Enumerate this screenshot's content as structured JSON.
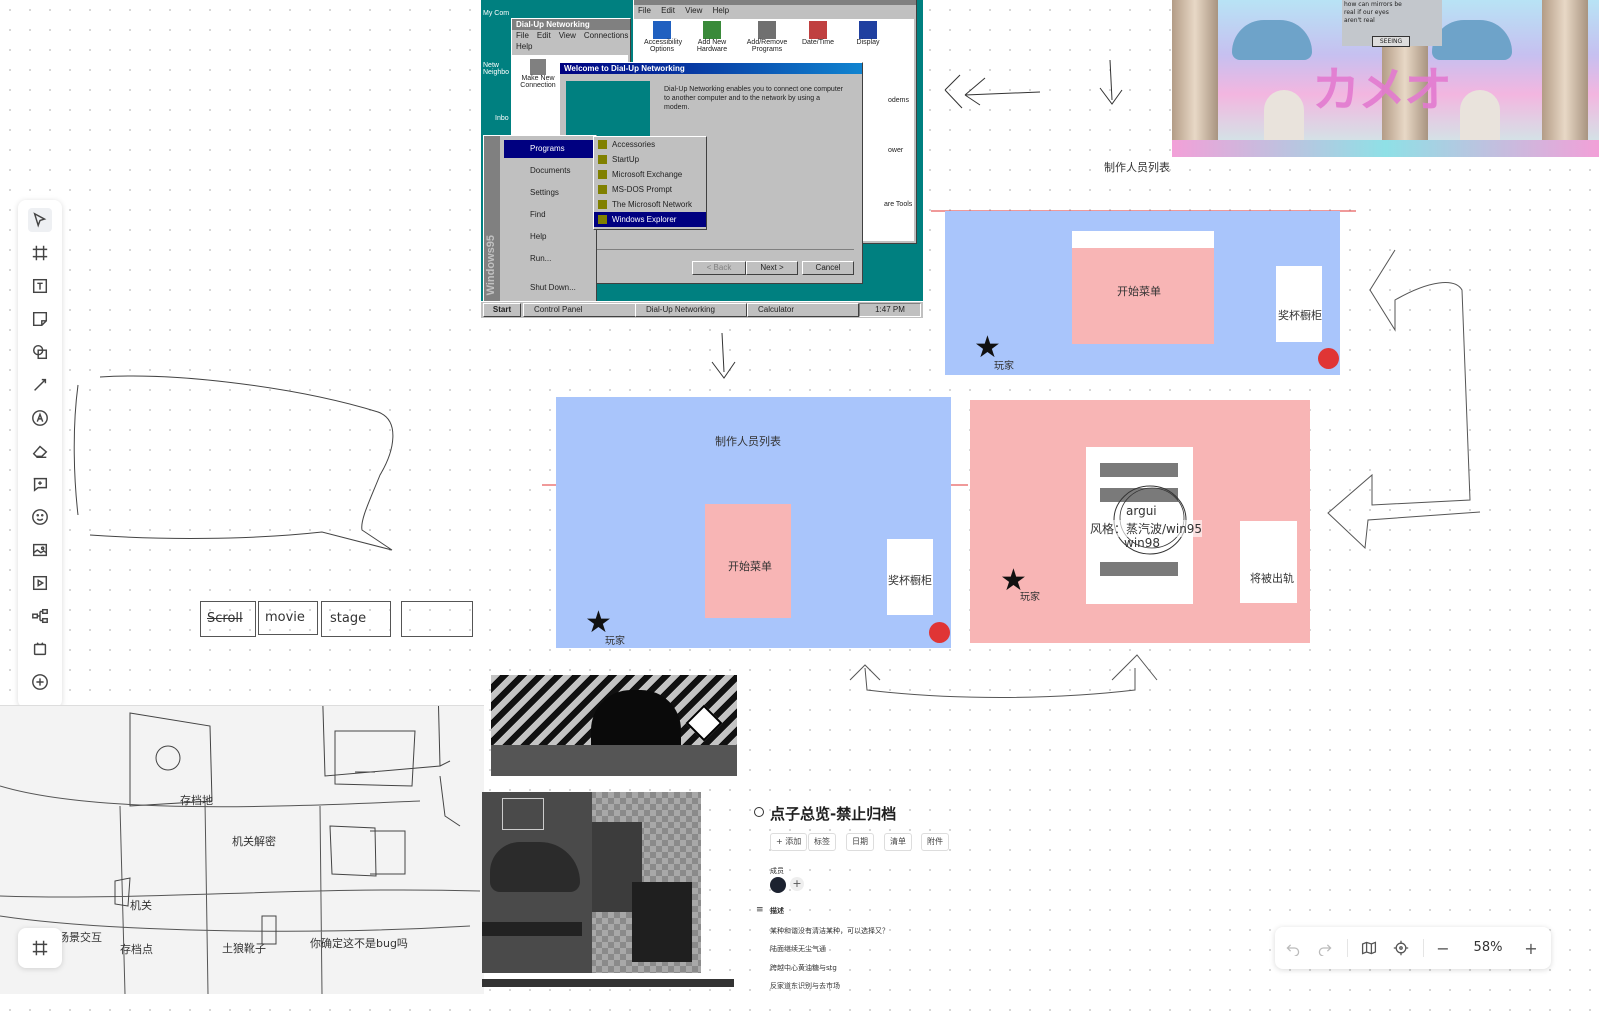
{
  "toolbar": {
    "tools": [
      "select-icon",
      "frame-icon",
      "text-box-icon",
      "sticky-note-icon",
      "shape-icon",
      "connector-icon",
      "pen-icon",
      "eraser-icon",
      "comment-icon",
      "emoji-icon",
      "image-icon",
      "media-icon",
      "mindmap-icon",
      "template-icon",
      "more-icon"
    ]
  },
  "win95": {
    "control_panel_menu": [
      "File",
      "Edit",
      "View",
      "Help"
    ],
    "cp_icons": [
      "Accessibility Options",
      "Add New Hardware",
      "Add/Remove Programs",
      "Date/Time",
      "Display"
    ],
    "cp_side": [
      "odems",
      "ower",
      "are Tools"
    ],
    "dun_title": "Dial-Up Networking",
    "dun_menu": [
      "File",
      "Edit",
      "View",
      "Connections"
    ],
    "dun_menu2": "Help",
    "dun_icon_label": "Make New Connection",
    "desktop_labels": [
      "My Com",
      "Netw Neighbo",
      "Inbo"
    ],
    "welcome_title": "Welcome to Dial-Up Networking",
    "welcome_text": "Dial-Up Networking enables you to connect one computer to another computer and to the network by using a modem.",
    "btn_back": "< Back",
    "btn_next": "Next >",
    "btn_cancel": "Cancel",
    "start_items": [
      "Programs",
      "Documents",
      "Settings",
      "Find",
      "Help",
      "Run...",
      "Shut Down..."
    ],
    "sub_items": [
      "Accessories",
      "StartUp",
      "Microsoft Exchange",
      "MS-DOS Prompt",
      "The Microsoft Network",
      "Windows Explorer"
    ],
    "brand": "Windows95",
    "taskbar": [
      "Start",
      "Control Panel",
      "Dial-Up Networking",
      "Calculator"
    ],
    "clock": "1:47 PM"
  },
  "vapor": {
    "text": "how can mirrors be real if our eyes aren't real",
    "button": "SEEING",
    "katakana": "カメオ"
  },
  "labels": {
    "credits_top": "制作人员列表",
    "credits_mid": "制作人员列表",
    "start_menu_1": "开始菜单",
    "trophy_1": "奖杯橱柜",
    "player_1": "玩家",
    "start_menu_2": "开始菜单",
    "trophy_2": "奖杯橱柜",
    "player_2": "玩家",
    "player_3": "玩家",
    "derail": "将被出轨",
    "argui": "argui",
    "style": "风格：蒸汽波/win95",
    "win98": "win98"
  },
  "handwritten": {
    "boxes": [
      "Scroll",
      "movie",
      "stage",
      ""
    ],
    "save_point": "存档地",
    "mechanism_puzzle": "机关解密",
    "mechanism": "机关",
    "scene_interaction": "场景交互",
    "save_point2": "存档点",
    "earth_wolf": "土狼靴子",
    "sure_bug": "你确定这不是bug吗"
  },
  "doc": {
    "title": "点子总览-禁止归档",
    "chips": [
      "+ 添加",
      "标签",
      "日期",
      "清单",
      "附件"
    ],
    "members_label": "成员",
    "desc_label": "描述",
    "lines": [
      "某种和谐没有清洁某种，可以选择又？",
      "陆面继续无尘气通",
      "跨越中心黄油糖与stg",
      "反家道东识别与去市场"
    ]
  },
  "zoom": {
    "level": "58%"
  }
}
